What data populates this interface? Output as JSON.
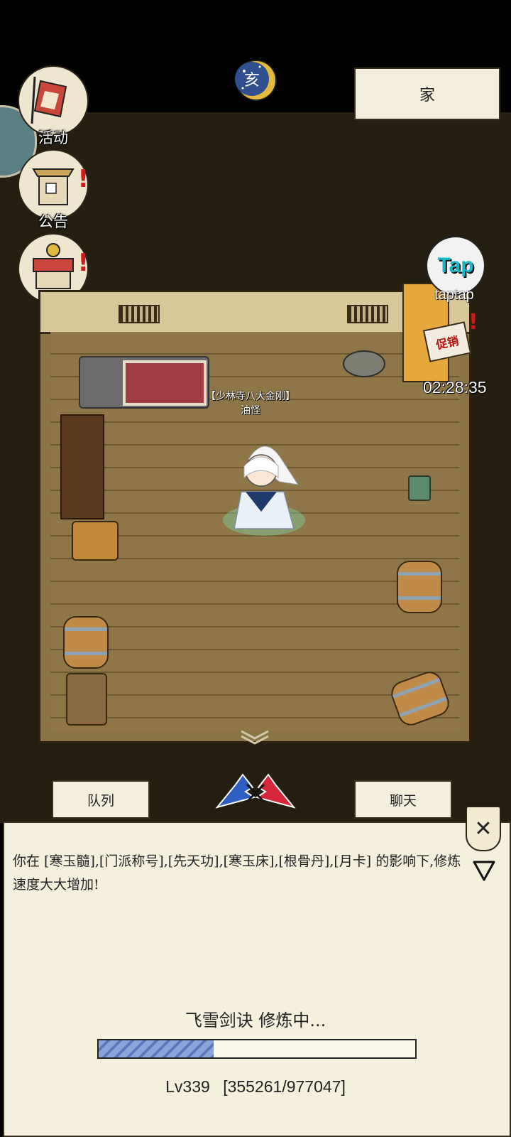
{
  "location": "家",
  "moon_glyph": "亥",
  "side_menu": [
    {
      "label": "活动",
      "has_alert": false
    },
    {
      "label": "公告",
      "has_alert": true
    },
    {
      "label": "商城",
      "has_alert": true
    }
  ],
  "npc": {
    "title": "【少林寺八大金刚】",
    "name": "油怪"
  },
  "taptap": {
    "logo_text": "Tap",
    "caption": "taptap"
  },
  "promo": {
    "sign_text": "促销",
    "alert": "!",
    "timer": "02:28:35"
  },
  "tabs": {
    "left": "队列",
    "right": "聊天"
  },
  "panel": {
    "message": "你在 [寒玉髓],[门派称号],[先天功],[寒玉床],[根骨丹],[月卡] 的影响下,修炼速度大大增加!",
    "close_symbol": "✕"
  },
  "training": {
    "title": "飞雪剑诀 修炼中...",
    "progress_fraction": 0.364,
    "level": "Lv339",
    "exp": "[355261/977047]"
  },
  "badge_symbol": "!",
  "colors": {
    "alert": "#d31a1a",
    "panel_bg": "#f5efde",
    "progress_fill": "#7a96cf"
  }
}
